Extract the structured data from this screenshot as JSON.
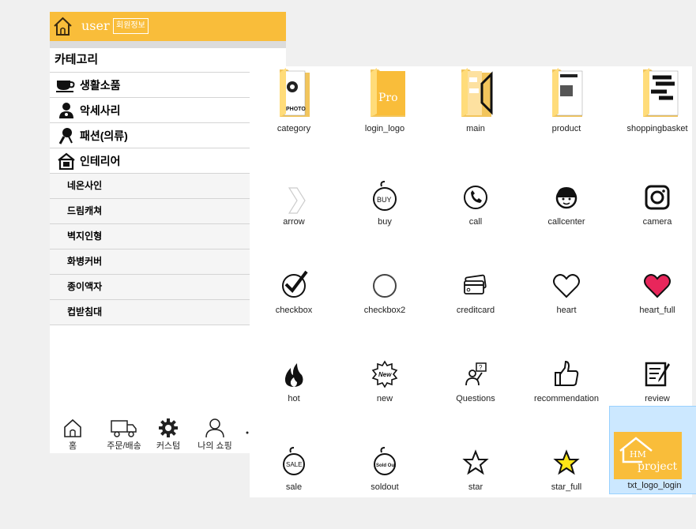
{
  "app": {
    "header": {
      "user": "user",
      "member_info": "회원정보"
    },
    "category_title": "카테고리",
    "main_items": [
      {
        "label": "생활소품",
        "icon": "coffee-cup-icon"
      },
      {
        "label": "악세사리",
        "icon": "accessory-icon"
      },
      {
        "label": "패션(의류)",
        "icon": "fashion-icon"
      },
      {
        "label": "인테리어",
        "icon": "interior-icon"
      }
    ],
    "sub_items": [
      "네온사인",
      "드림캐쳐",
      "벽지인형",
      "화병커버",
      "종이액자",
      "컵받침대"
    ],
    "bottom_nav": [
      {
        "label": "홈",
        "icon": "home-icon"
      },
      {
        "label": "주문/배송",
        "icon": "truck-icon"
      },
      {
        "label": "커스텀",
        "icon": "gear-icon"
      },
      {
        "label": "나의 쇼핑",
        "icon": "person-icon"
      }
    ]
  },
  "explorer": {
    "items": [
      {
        "name": "category",
        "icon": "folder-icon"
      },
      {
        "name": "login_logo",
        "icon": "folder-icon"
      },
      {
        "name": "main",
        "icon": "folder-icon"
      },
      {
        "name": "product",
        "icon": "folder-icon"
      },
      {
        "name": "shoppingbasket",
        "icon": "folder-icon"
      },
      {
        "name": "arrow",
        "icon": "arrow-icon"
      },
      {
        "name": "buy",
        "icon": "buy-icon"
      },
      {
        "name": "call",
        "icon": "phone-icon"
      },
      {
        "name": "callcenter",
        "icon": "callcenter-icon"
      },
      {
        "name": "camera",
        "icon": "camera-icon"
      },
      {
        "name": "checkbox",
        "icon": "checkbox-checked-icon"
      },
      {
        "name": "checkbox2",
        "icon": "checkbox-empty-icon"
      },
      {
        "name": "creditcard",
        "icon": "creditcard-icon"
      },
      {
        "name": "heart",
        "icon": "heart-icon"
      },
      {
        "name": "heart_full",
        "icon": "heart-full-icon"
      },
      {
        "name": "hot",
        "icon": "fire-icon"
      },
      {
        "name": "new",
        "icon": "new-badge-icon"
      },
      {
        "name": "Questions",
        "icon": "questions-icon"
      },
      {
        "name": "recommendation",
        "icon": "thumbs-up-icon"
      },
      {
        "name": "review",
        "icon": "review-icon"
      },
      {
        "name": "sale",
        "icon": "sale-icon"
      },
      {
        "name": "soldout",
        "icon": "soldout-icon"
      },
      {
        "name": "star",
        "icon": "star-icon"
      },
      {
        "name": "star_full",
        "icon": "star-full-icon"
      },
      {
        "name": "txt_logo_login",
        "icon": "hm-project-logo-icon"
      }
    ],
    "thumb_texts": {
      "category": "PHOTO",
      "login_logo": "Pro",
      "buy": "BUY",
      "new": "New",
      "sale": "SALE",
      "soldout": "Sold Out",
      "logo_hm": "HM",
      "logo_project": "project"
    },
    "selected": "txt_logo_login"
  },
  "colors": {
    "header": "#f9bd3a",
    "folder": "#ffdc7a",
    "selection": "#cce8ff",
    "heart_full": "#e8265b",
    "star_full": "#ffe617"
  }
}
